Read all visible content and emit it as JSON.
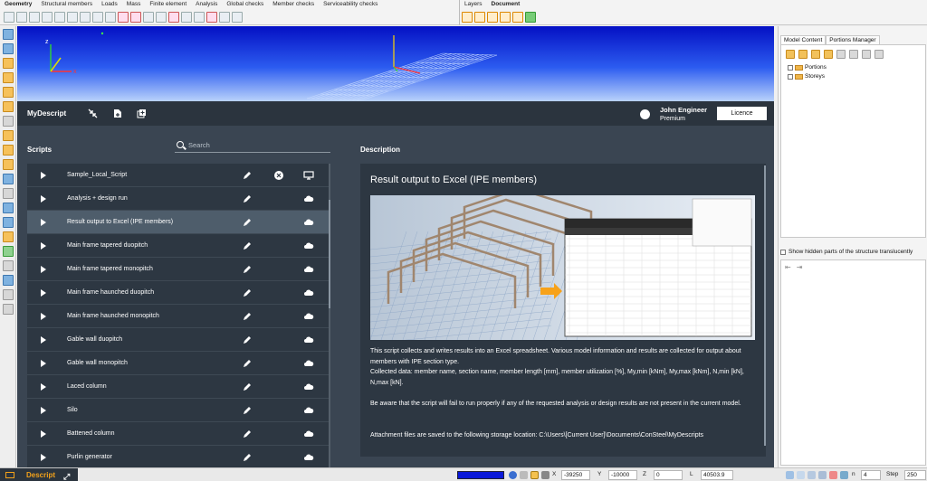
{
  "menu": {
    "tabs": [
      "Geometry",
      "Structural members",
      "Loads",
      "Mass",
      "Finite element",
      "Analysis",
      "Global checks",
      "Member checks",
      "Serviceability checks"
    ],
    "right_tabs": [
      "Layers",
      "Document"
    ]
  },
  "viewport": {
    "axis_x": "x",
    "axis_y": "y",
    "axis_z": "z"
  },
  "header": {
    "title": "MyDescript",
    "user_name": "John Engineer",
    "user_plan": "Premium",
    "licence_button": "Licence"
  },
  "scripts": {
    "heading": "Scripts",
    "search_placeholder": "Search",
    "items": [
      {
        "label": "Sample_Local_Script",
        "extra_icons": true
      },
      {
        "label": "Analysis + design run"
      },
      {
        "label": "Result output to Excel (IPE members)",
        "selected": true
      },
      {
        "label": "Main frame tapered duopitch"
      },
      {
        "label": "Main frame tapered monopitch"
      },
      {
        "label": "Main frame haunched duopitch"
      },
      {
        "label": "Main frame haunched monopitch"
      },
      {
        "label": "Gable wall duopitch"
      },
      {
        "label": "Gable wall monopitch"
      },
      {
        "label": "Laced column"
      },
      {
        "label": "Silo"
      },
      {
        "label": "Battened column"
      },
      {
        "label": "Purlin generator"
      }
    ]
  },
  "description": {
    "heading": "Description",
    "title": "Result output to Excel (IPE members)",
    "para1": "This script collects and writes results into an Excel spreadsheet. Various model information and results are collected for output about members with IPE section type.",
    "para1b": "Collected data: member name, section name, member length [mm], member utilization [%], My,min [kNm], My,max [kNm], N,min [kN], N,max [kN].",
    "para2": "Be aware that the script will fail to run properly if any of the requested analysis or design results are not present in the current model.",
    "para3": "Attachment files are saved to the following storage location: C:\\Users\\[Current User]\\Documents\\ConSteel\\MyDescripts"
  },
  "right_panel": {
    "tabs": [
      "Model Content",
      "Portions Manager"
    ],
    "tree": [
      "Portions",
      "Storeys"
    ],
    "hidden_checkbox": "Show hidden parts of the structure translucently"
  },
  "statusbar": {
    "tab_label": "Descript",
    "x_label": "X",
    "x_value": "-39250",
    "y_label": "Y",
    "y_value": "-10000",
    "z_label": "Z",
    "z_value": "0",
    "l_label": "L",
    "l_value": "40503.9",
    "n_label": "n",
    "n_value": "4",
    "step_label": "Step",
    "step_value": "250"
  },
  "colors": {
    "accent": "#f2a11a",
    "panel": "#3a4552",
    "header": "#2b343e",
    "selected_row": "#4e5d6b"
  }
}
